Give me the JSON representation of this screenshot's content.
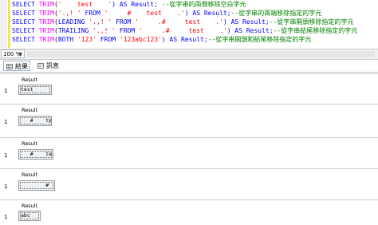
{
  "editor": {
    "lines": [
      {
        "prefix": "SELECT ",
        "fn": "TRIM",
        "open": "(",
        "str1": "'    test    '",
        "mid": ") AS Result; ",
        "comment": "--從字串的兩側移除空白字元"
      },
      {
        "prefix": "SELECT ",
        "fn": "TRIM",
        "open": "(",
        "str1": "'.,! '",
        "mid": " FROM ",
        "str2": "'     #    test    .'",
        "end": ") AS Result;",
        "comment": "--從字串的兩端移除指定的字元"
      },
      {
        "prefix": "SELECT ",
        "fn": "TRIM",
        "open": "(",
        "kw2": "LEADING ",
        "str1": "'.,! '",
        "mid": " FROM ",
        "str2": "'     .#     test    .'",
        "end": ") AS Result;",
        "comment": "--從字串開頭移除指定的字元"
      },
      {
        "prefix": "SELECT ",
        "fn": "TRIM",
        "open": "(",
        "kw2": "TRAILING ",
        "str1": "'.,! '",
        "mid": " FROM ",
        "str2": "'     .#     test    .'",
        "end": ") AS Result;",
        "comment": "--從字串結尾移除指定的字元"
      },
      {
        "prefix": "SELECT ",
        "fn": "TRIM",
        "open": "(",
        "kw2": "BOTH ",
        "str1": "'123'",
        "mid": " FROM ",
        "str2": "'123abc123'",
        "end": ") AS Result;",
        "comment": "--從字串開頭和結尾移除指定的字元"
      }
    ]
  },
  "zoom": {
    "value": "100 %"
  },
  "tabs": {
    "results": "結果",
    "messages": "訊息"
  },
  "results": [
    {
      "header": "Result",
      "row": "1",
      "value": "test"
    },
    {
      "header": "Result",
      "row": "1",
      "value": "   #    test"
    },
    {
      "header": "Result",
      "row": "1",
      "value": "   #    test  ."
    },
    {
      "header": "Result",
      "row": "1",
      "value": "        #     test"
    },
    {
      "header": "Result",
      "row": "1",
      "value": "abc"
    }
  ],
  "colors": {
    "keyword": "#0000ff",
    "function": "#ff00ff",
    "string": "#ff0000",
    "comment": "#008000",
    "marker": "#f7e35c"
  }
}
